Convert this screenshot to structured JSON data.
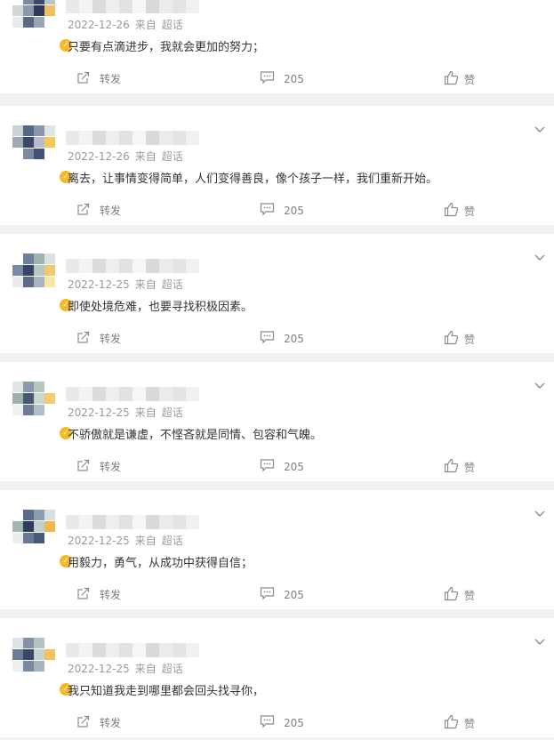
{
  "comments": [
    {
      "date": "2022-12-26",
      "via": "来自",
      "source": "超话",
      "text": "只要有点滴进步，我就会更加的努力；",
      "repost_label": "转发",
      "comment_count": "205",
      "like_label": "赞",
      "avatar_colors": [
        "#ffffff",
        "#7a8aa0",
        "#3d4a6b",
        "#b8c4cc",
        "#cfd8da",
        "#8c98aa",
        "#2f3a5a",
        "#f0c060",
        "#e6ecec",
        "#5a6786",
        "#9aa6b6",
        "#ffffff"
      ]
    },
    {
      "date": "2022-12-26",
      "via": "来自",
      "source": "超话",
      "text": "离去，让事情变得简单，人们变得善良，像个孩子一样，我们重新开始。",
      "repost_label": "转发",
      "comment_count": "205",
      "like_label": "赞",
      "avatar_colors": [
        "#c9d3d4",
        "#566888",
        "#8a97ab",
        "#dfe5e6",
        "#9eaab6",
        "#3b4668",
        "#b3bcc8",
        "#f5c85a",
        "#ffffff",
        "#7c89a0",
        "#44507a",
        "#ffffff"
      ]
    },
    {
      "date": "2022-12-25",
      "via": "来自",
      "source": "超话",
      "text": "即使处境危难，也要寻找积极因素。",
      "repost_label": "转发",
      "comment_count": "205",
      "like_label": "赞",
      "avatar_colors": [
        "#ffffff",
        "#6f7f98",
        "#9fb4b0",
        "#d9e1e2",
        "#7b8aa3",
        "#384468",
        "#b8c7c3",
        "#f2c86a",
        "#e7eced",
        "#5d6b8a",
        "#a8b4c0",
        "#fbe4a6"
      ]
    },
    {
      "date": "2022-12-25",
      "via": "来自",
      "source": "超话",
      "text": "不骄傲就是谦虚，不悭吝就是同情、包容和气魄。",
      "repost_label": "转发",
      "comment_count": "205",
      "like_label": "赞",
      "avatar_colors": [
        "#dfe6e4",
        "#8a98ac",
        "#b5c6bf",
        "#ffffff",
        "#9fb0ac",
        "#4a5676",
        "#c9d6d0",
        "#f4cc70",
        "#eef2f1",
        "#6e7b96",
        "#b0bec6",
        "#ffffff"
      ]
    },
    {
      "date": "2022-12-25",
      "via": "来自",
      "source": "超话",
      "text": "用毅力，勇气，从成功中获得自信；",
      "repost_label": "转发",
      "comment_count": "205",
      "like_label": "赞",
      "avatar_colors": [
        "#ffffff",
        "#5b6c8a",
        "#8d9cb0",
        "#d7dfe0",
        "#a3b6b0",
        "#2e3a5e",
        "#c2cfca",
        "#f0b84e",
        "#e9eeee",
        "#6a7894",
        "#4a5878",
        "#ffffff"
      ]
    },
    {
      "date": "2022-12-25",
      "via": "来自",
      "source": "超话",
      "text": "我只知道我走到哪里都会回头找寻你，",
      "repost_label": "转发",
      "comment_count": "205",
      "like_label": "赞",
      "avatar_colors": [
        "#dde4e5",
        "#8392a8",
        "#b4c3c2",
        "#ffffff",
        "#6d7c96",
        "#3a4668",
        "#c6d2d0",
        "#f4c25c",
        "#eaf0ef",
        "#788aa2",
        "#a6b4bc",
        "#ffffff"
      ]
    }
  ],
  "name_mosaic_colors": [
    "#e9e9e9",
    "#f3f3f3",
    "#dcdcdc",
    "#eeeeee",
    "#e2e2e2",
    "#f6f6f6",
    "#d9d9d9",
    "#ececec",
    "#e4e4e4",
    "#f1f1f1"
  ],
  "icons": {
    "repost": "repost-icon",
    "comment": "comment-icon",
    "like": "thumbs-up-icon",
    "expand": "chevron-down-icon",
    "verified": "verified-badge-icon"
  },
  "colors": {
    "verified_badge": "#f6b925",
    "meta_text": "#9a9a9a",
    "body_text": "#333333",
    "action_text": "#808080"
  }
}
